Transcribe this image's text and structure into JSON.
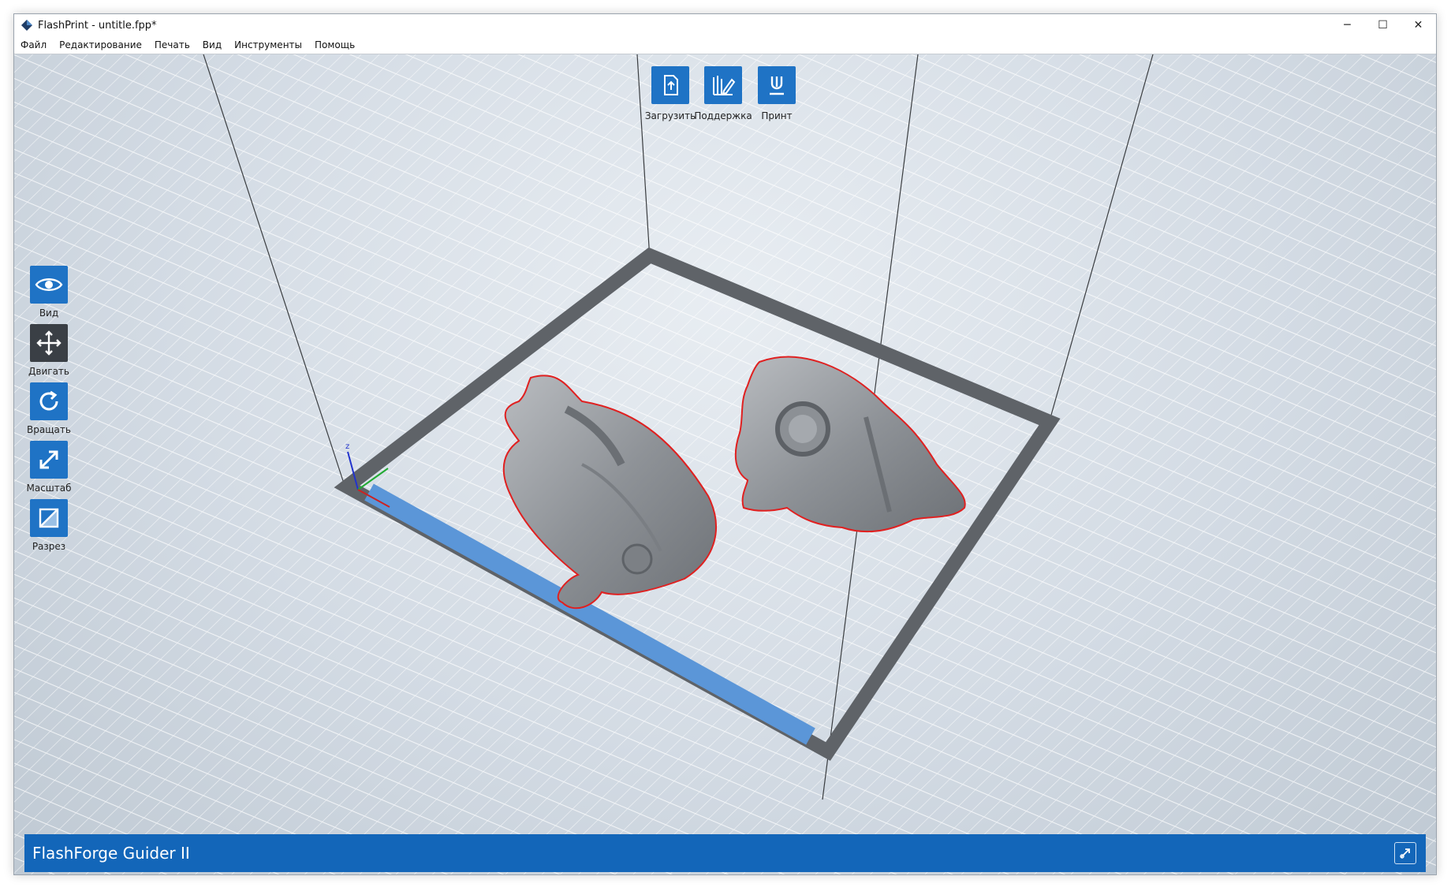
{
  "window": {
    "title": "FlashPrint - untitle.fpp*",
    "controls": {
      "minimize": "─",
      "maximize": "☐",
      "close": "✕"
    }
  },
  "menu": {
    "items": [
      "Файл",
      "Редактирование",
      "Печать",
      "Вид",
      "Инструменты",
      "Помощь"
    ]
  },
  "toolbar": {
    "load_label": "Загрузить",
    "support_label": "Поддержка",
    "print_label": "Принт"
  },
  "side_tools": {
    "view_label": "Вид",
    "move_label": "Двигать",
    "rotate_label": "Вращать",
    "scale_label": "Масштаб",
    "cut_label": "Разрез"
  },
  "scene": {
    "axis_z_label": "z",
    "model_count": 2,
    "selected_outline_color": "#e02020",
    "front_edge_color": "#5b96d8",
    "build_plate_frame_color": "#5f6368"
  },
  "status": {
    "printer_name": "FlashForge Guider II"
  },
  "colors": {
    "accent": "#1f73c5",
    "status_bar": "#1366b9",
    "active_tool": "#3a3f45"
  }
}
